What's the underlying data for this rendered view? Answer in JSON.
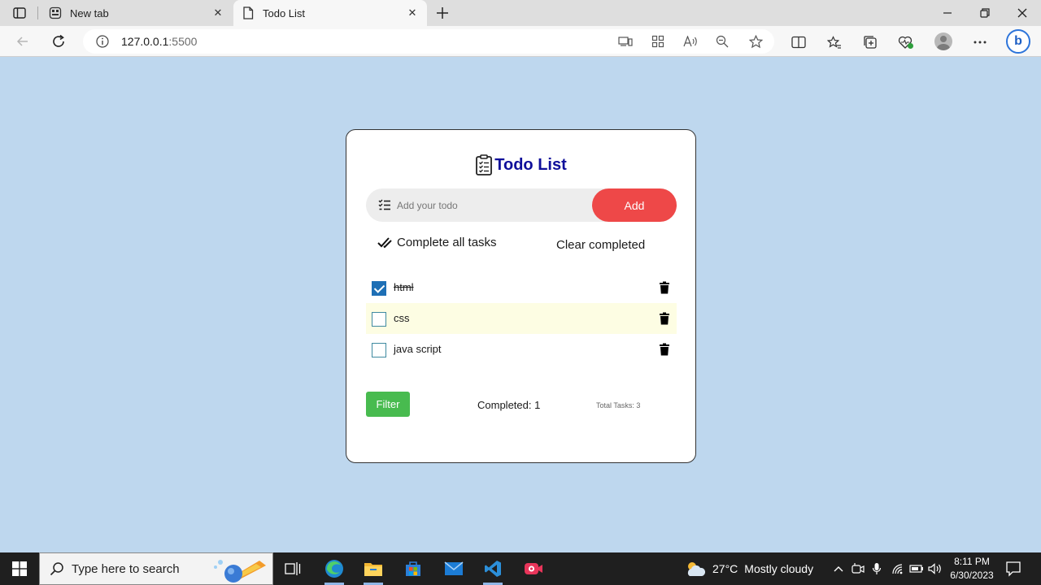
{
  "browser": {
    "tabs": [
      {
        "title": "New tab",
        "icon": "newtab-icon"
      },
      {
        "title": "Todo List",
        "icon": "page-icon"
      }
    ],
    "url_host": "127.0.0.1",
    "url_port": ":5500"
  },
  "app": {
    "title": "Todo List",
    "input_placeholder": "Add your todo",
    "add_label": "Add",
    "complete_all_label": "Complete all tasks",
    "clear_completed_label": "Clear completed",
    "todos": [
      {
        "text": "html",
        "completed": true
      },
      {
        "text": "css",
        "completed": false
      },
      {
        "text": "java script",
        "completed": false
      }
    ],
    "filter_label": "Filter",
    "completed_text": "Completed: 1",
    "total_text": "Total Tasks: 3",
    "colors": {
      "title": "#0f0f9a",
      "add_button": "#ee4848",
      "filter_button": "#48bb4f",
      "checkbox_checked": "#1e6fb5",
      "background": "#bed7ee"
    }
  },
  "taskbar": {
    "search_placeholder": "Type here to search",
    "weather_temp": "27°C",
    "weather_desc": "Mostly cloudy",
    "time": "8:11 PM",
    "date": "6/30/2023"
  }
}
